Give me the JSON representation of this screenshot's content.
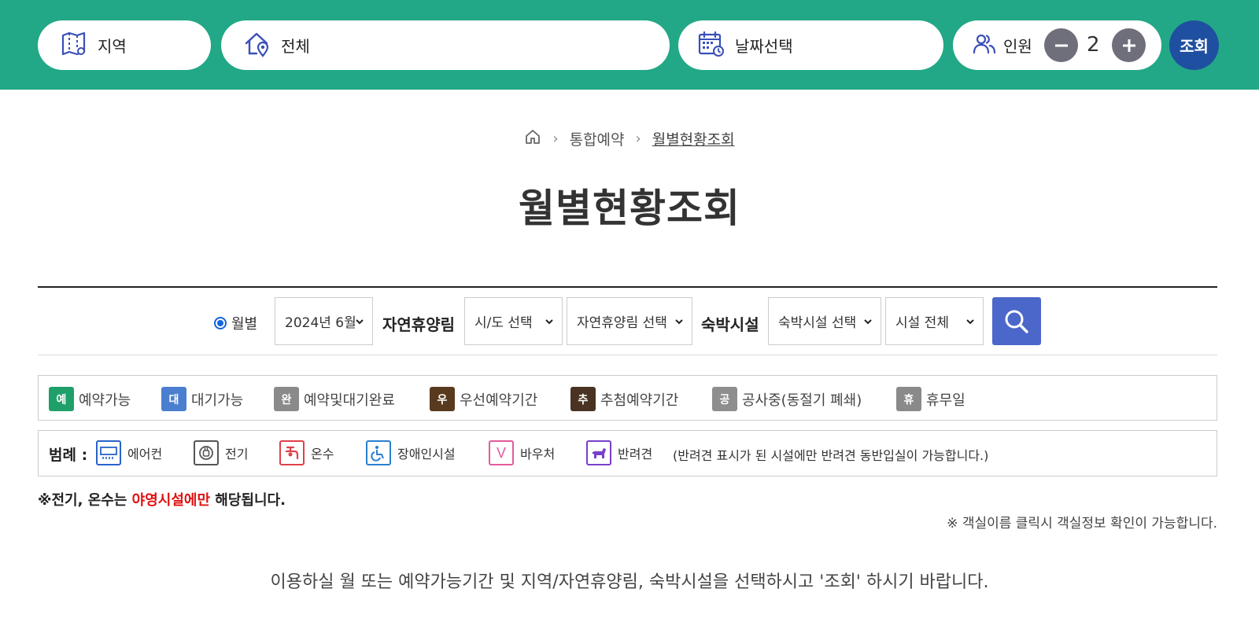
{
  "topbar": {
    "region_label": "지역",
    "facility_label": "전체",
    "date_label": "날짜선택",
    "people_label": "인원",
    "people_count": "2",
    "search_label": "조회",
    "color": "#22a886"
  },
  "breadcrumb": {
    "items": [
      "통합예약",
      "월별현황조회"
    ]
  },
  "page_title": "월별현황조회",
  "filters": {
    "radio_label": "월별",
    "month_value": "2024년 6월",
    "forest_label": "자연휴양림",
    "province_value": "시/도 선택",
    "forest_value": "자연휴양림 선택",
    "lodging_label": "숙박시설",
    "lodging_value": "숙박시설 선택",
    "facility_value": "시설 전체"
  },
  "status_legend": [
    {
      "badge": "예",
      "label": "예약가능",
      "color": "#1fa06b"
    },
    {
      "badge": "대",
      "label": "대기가능",
      "color": "#4a7fd0"
    },
    {
      "badge": "완",
      "label": "예약및대기완료",
      "color": "#8a8a8a"
    },
    {
      "badge": "우",
      "label": "우선예약기간",
      "color": "#5a3a1e"
    },
    {
      "badge": "추",
      "label": "추첨예약기간",
      "color": "#4a3322"
    },
    {
      "badge": "공",
      "label": "공사중(동절기 폐쇄)",
      "color": "#8e8e8e"
    },
    {
      "badge": "휴",
      "label": "휴무일",
      "color": "#8a8a8a"
    }
  ],
  "amenity_legend": {
    "title": "범례 :",
    "items": [
      {
        "icon": "aircon-icon",
        "label": "에어컨",
        "color": "#2a62c9"
      },
      {
        "icon": "electric-icon",
        "label": "전기",
        "color": "#555555"
      },
      {
        "icon": "hot-water-icon",
        "label": "온수",
        "color": "#e0404a"
      },
      {
        "icon": "wheelchair-icon",
        "label": "장애인시설",
        "color": "#2a7fd0"
      },
      {
        "icon": "voucher-icon",
        "label": "바우처",
        "color": "#e25b9c"
      },
      {
        "icon": "pet-icon",
        "label": "반려견",
        "color": "#7a3fc9"
      }
    ],
    "note": "(반려견 표시가 된 시설에만 반려견 동반입실이 가능합니다.)"
  },
  "notes": {
    "left_prefix": "※전기, 온수는 ",
    "left_highlight": "야영시설에만",
    "left_suffix": " 해당됩니다.",
    "right": "※ 객실이름 클릭시 객실정보 확인이 가능합니다."
  },
  "guide": "이용하실 월 또는 예약가능기간 및 지역/자연휴양림, 숙박시설을 선택하시고 '조회' 하시기 바랍니다."
}
